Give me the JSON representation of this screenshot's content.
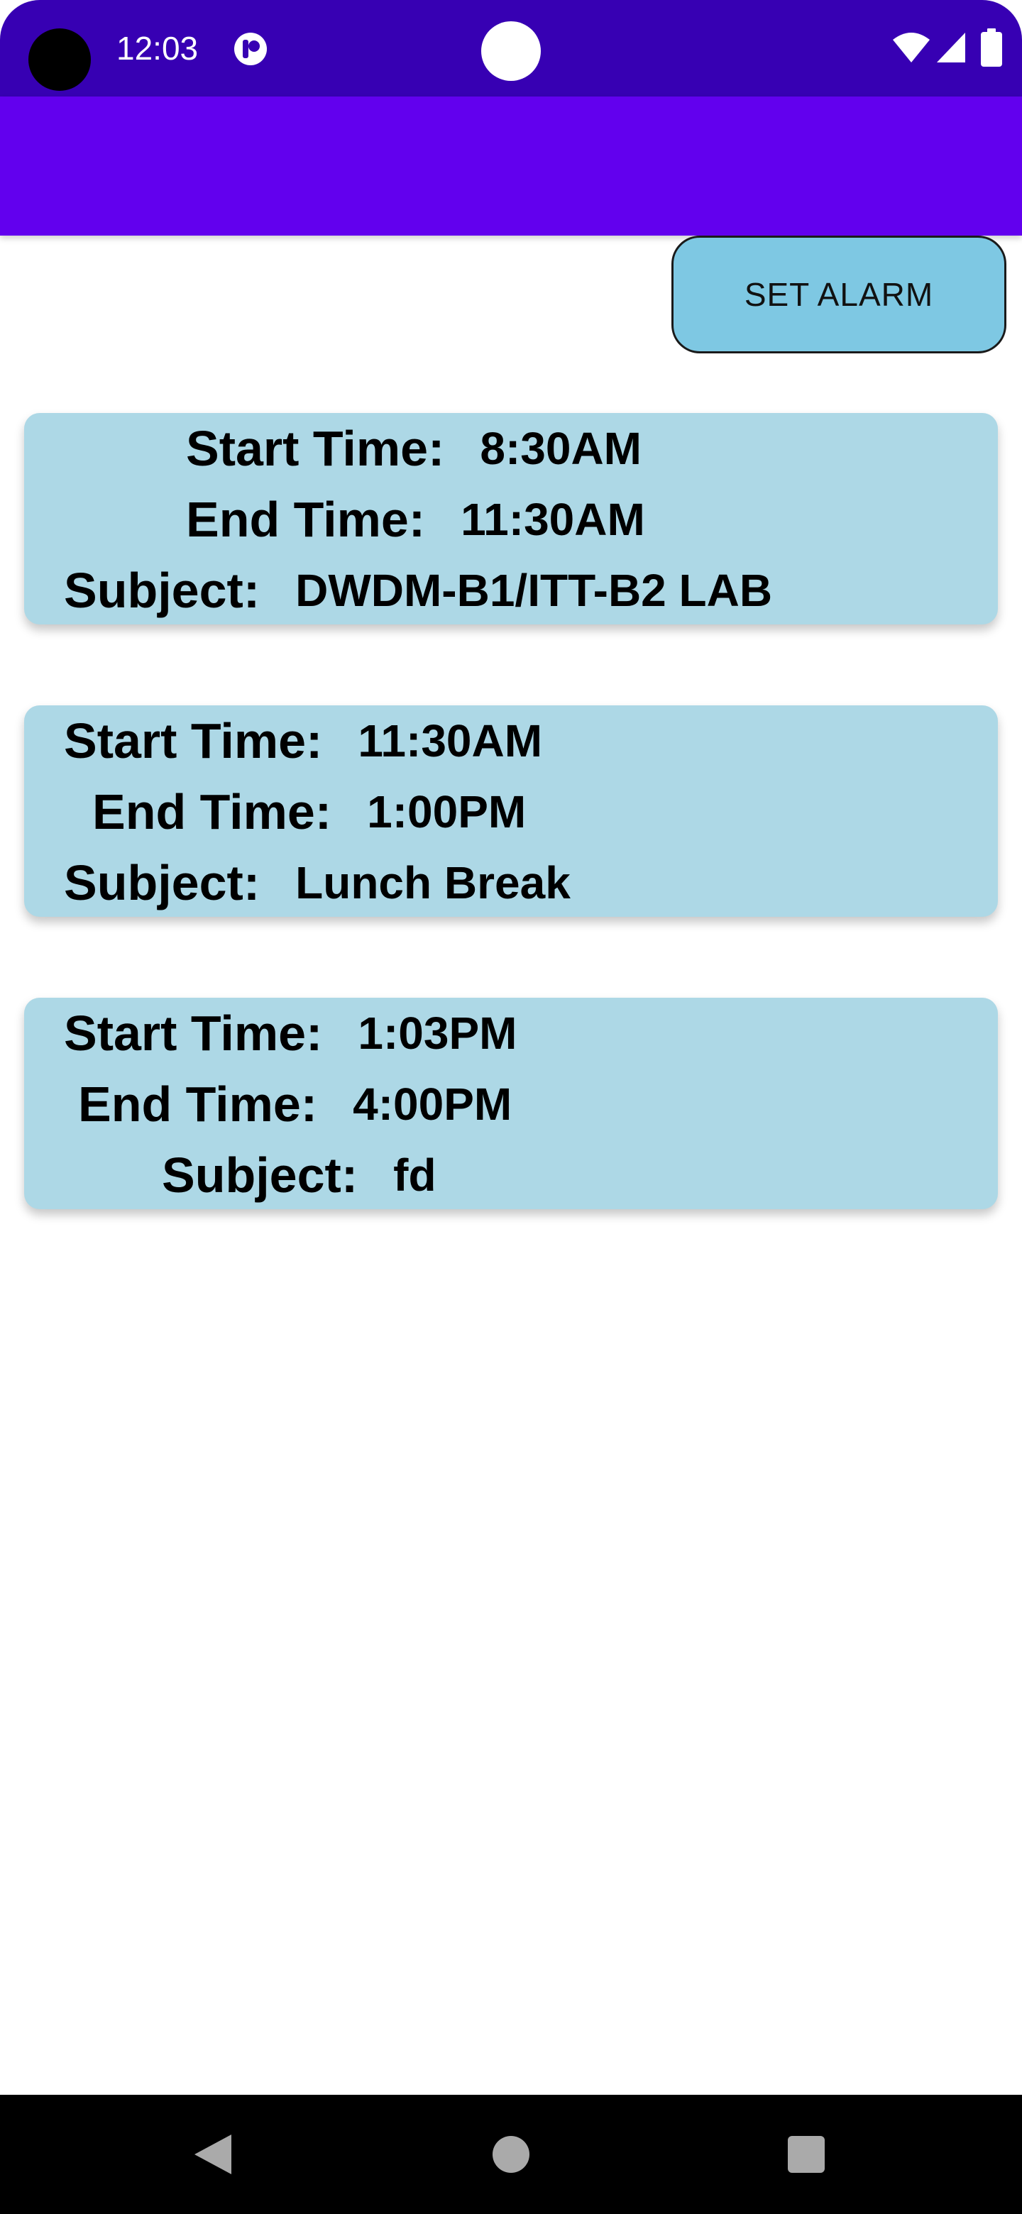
{
  "status_bar": {
    "time": "12:03",
    "icons": [
      "camera-dot",
      "notification-icon",
      "wifi-icon",
      "signal-icon",
      "battery-icon"
    ]
  },
  "actions": {
    "set_alarm_label": "SET ALARM"
  },
  "schedule": [
    {
      "start_label": "Start Time:",
      "start_value": "8:30AM",
      "end_label": "End Time:",
      "end_value": "11:30AM",
      "subject_label": "Subject:",
      "subject_value": "DWDM-B1/ITT-B2 LAB"
    },
    {
      "start_label": "Start Time:",
      "start_value": "11:30AM",
      "end_label": "End Time:",
      "end_value": "1:00PM",
      "subject_label": "Subject:",
      "subject_value": "Lunch Break"
    },
    {
      "start_label": "Start Time:",
      "start_value": "1:03PM",
      "end_label": "End Time:",
      "end_value": "4:00PM",
      "subject_label": "Subject:",
      "subject_value": "fd"
    }
  ],
  "nav_bar": {
    "icons": [
      "back-icon",
      "home-icon",
      "recents-icon"
    ]
  },
  "colors": {
    "status_bar": "#3700b3",
    "app_bar": "#6200ee",
    "button": "#7ec8e3",
    "card": "#add8e6"
  }
}
